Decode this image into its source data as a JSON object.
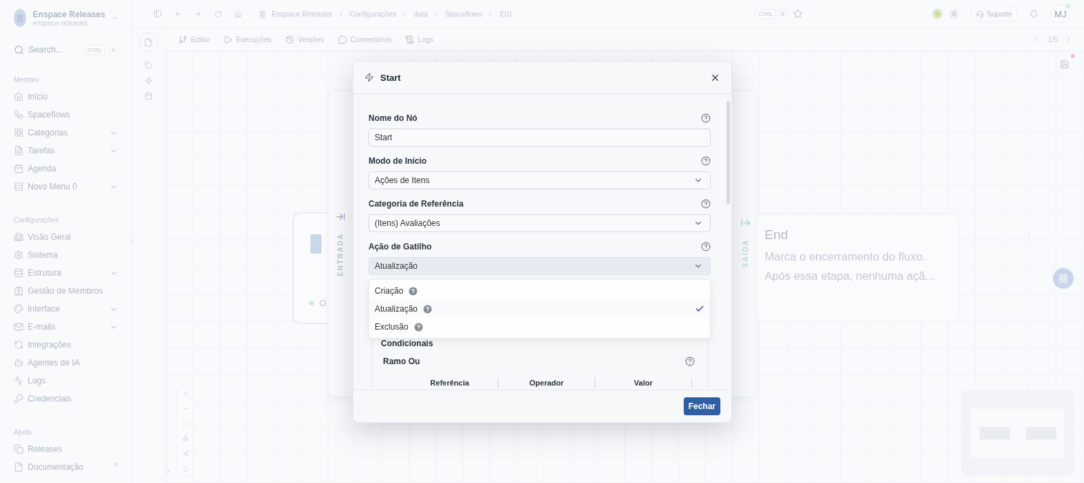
{
  "workspace": {
    "name": "Enspace Releases",
    "slug": "enspace-releases"
  },
  "search": {
    "placeholder": "Search...",
    "keys": [
      "CTRL",
      "K"
    ]
  },
  "sidebar": {
    "sections": [
      {
        "title": "Membro",
        "items": [
          {
            "label": "Início",
            "expandable": false
          },
          {
            "label": "Spaceflows",
            "expandable": false
          },
          {
            "label": "Categorias",
            "expandable": true
          },
          {
            "label": "Tarefas",
            "expandable": true
          },
          {
            "label": "Agenda",
            "expandable": false
          },
          {
            "label": "Novo Menu 0",
            "expandable": true
          }
        ]
      },
      {
        "title": "Configurações",
        "items": [
          {
            "label": "Visão Geral",
            "expandable": false
          },
          {
            "label": "Sistema",
            "expandable": false
          },
          {
            "label": "Estrutura",
            "expandable": true
          },
          {
            "label": "Gestão de Membros",
            "expandable": false
          },
          {
            "label": "Interface",
            "expandable": true
          },
          {
            "label": "E-mails",
            "expandable": true
          },
          {
            "label": "Integrações",
            "expandable": false
          },
          {
            "label": "Agentes de IA",
            "expandable": false
          },
          {
            "label": "Logs",
            "expandable": false
          },
          {
            "label": "Credenciais",
            "expandable": false
          }
        ]
      },
      {
        "title": "Ajuda",
        "items": [
          {
            "label": "Releases",
            "expandable": false
          },
          {
            "label": "Documentação",
            "expandable": false,
            "external": true
          }
        ]
      }
    ]
  },
  "topbar": {
    "breadcrumb": [
      "Enspace Releases",
      "Configurações",
      "data",
      "Spaceflows",
      "210"
    ],
    "shortcut": [
      "CTRL",
      "B"
    ],
    "support": "Suporte",
    "avatar": "MJ"
  },
  "toolbar": {
    "tabs": [
      "Editor",
      "Execuções",
      "Versões",
      "Comentários",
      "Logs"
    ],
    "pager": "1/5"
  },
  "canvas": {
    "entry_label": "ENTRADA",
    "exit_label": "SAÍDA",
    "start_node": {
      "text": "O"
    },
    "end_node": {
      "title": "End",
      "lines": [
        "Marca o encerramento do fluxo.",
        "Após essa etapa, nenhuma açã..."
      ]
    }
  },
  "modal": {
    "title": "Start",
    "fields": [
      {
        "label": "Nome do Nó",
        "kind": "text",
        "value": "Start"
      },
      {
        "label": "Modo de Início",
        "kind": "select",
        "value": "Ações de Itens",
        "open": false
      },
      {
        "label": "Categoria de Referência",
        "kind": "select",
        "value": "(Itens) Avaliações",
        "open": false
      },
      {
        "label": "Ação de Gatilho",
        "kind": "select",
        "value": "Atualização",
        "open": true,
        "options": [
          {
            "label": "Criação",
            "selected": false
          },
          {
            "label": "Atualização",
            "selected": true
          },
          {
            "label": "Exclusão",
            "selected": false
          }
        ]
      }
    ],
    "conditionals": {
      "title": "Condicionais",
      "branch": "Ramo Ou",
      "columns": [
        "Referência",
        "Operador",
        "Valor"
      ]
    },
    "close_button": "Fechar"
  }
}
